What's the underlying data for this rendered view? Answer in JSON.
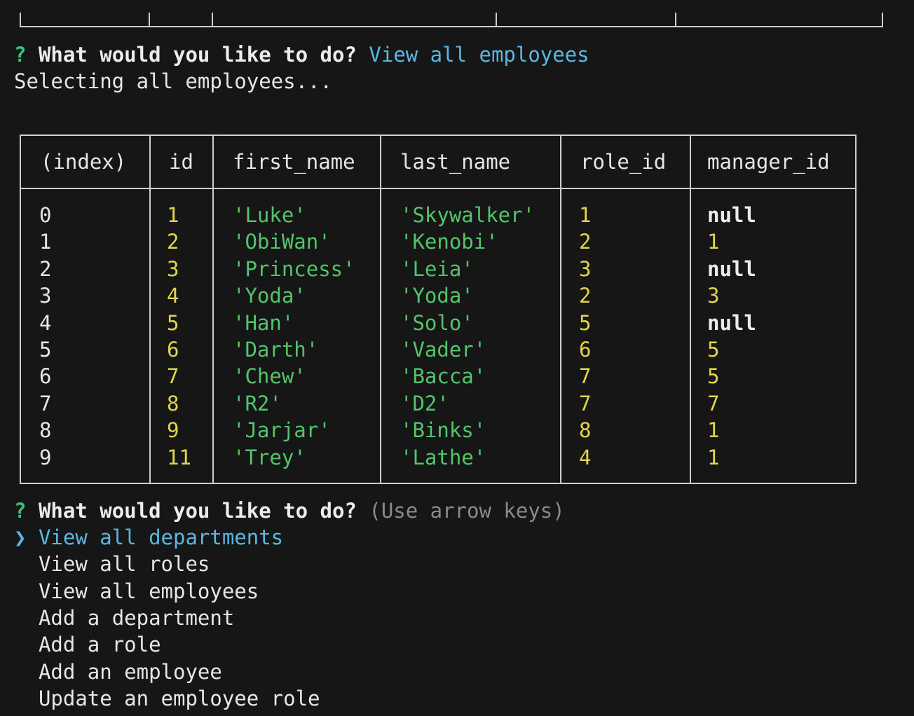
{
  "prompt1": {
    "qmark": "?",
    "question": "What would you like to do?",
    "answer": "View all employees"
  },
  "status_line": "Selecting all employees...",
  "table": {
    "headers": [
      "(index)",
      "id",
      "first_name",
      "last_name",
      "role_id",
      "manager_id"
    ],
    "rows": [
      [
        "0",
        "1",
        "'Luke'",
        "'Skywalker'",
        "1",
        "null"
      ],
      [
        "1",
        "2",
        "'ObiWan'",
        "'Kenobi'",
        "2",
        "1"
      ],
      [
        "2",
        "3",
        "'Princess'",
        "'Leia'",
        "3",
        "null"
      ],
      [
        "3",
        "4",
        "'Yoda'",
        "'Yoda'",
        "2",
        "3"
      ],
      [
        "4",
        "5",
        "'Han'",
        "'Solo'",
        "5",
        "null"
      ],
      [
        "5",
        "6",
        "'Darth'",
        "'Vader'",
        "6",
        "5"
      ],
      [
        "6",
        "7",
        "'Chew'",
        "'Bacca'",
        "7",
        "5"
      ],
      [
        "7",
        "8",
        "'R2'",
        "'D2'",
        "7",
        "7"
      ],
      [
        "8",
        "9",
        "'Jarjar'",
        "'Binks'",
        "8",
        "1"
      ],
      [
        "9",
        "11",
        "'Trey'",
        "'Lathe'",
        "4",
        "1"
      ]
    ]
  },
  "prompt2": {
    "qmark": "?",
    "question": "What would you like to do?",
    "hint": "(Use arrow keys)",
    "pointer": "❯",
    "choices": [
      "View all departments",
      "View all roles",
      "View all employees",
      "Add a department",
      "Add a role",
      "Add an employee",
      "Update an employee role"
    ],
    "selected_index": 0
  },
  "colors": {
    "background": "#161616",
    "prompt_qmark": "#3bbf7a",
    "answer": "#59b7e0",
    "number": "#e2d54a",
    "string": "#52c46a",
    "hint": "#8a8a8a"
  }
}
